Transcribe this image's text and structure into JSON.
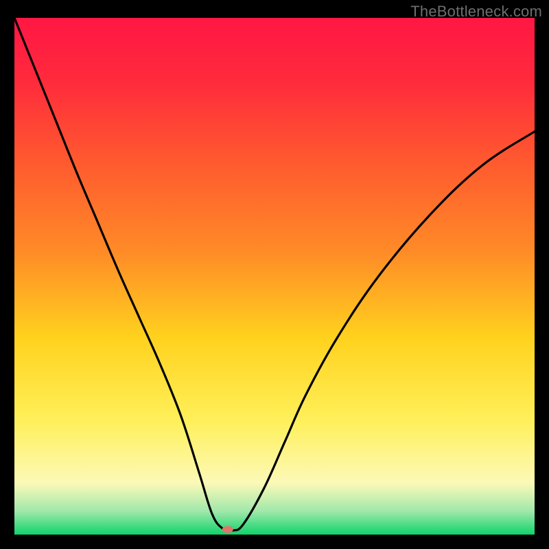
{
  "watermark": "TheBottleneck.com",
  "chart_data": {
    "type": "line",
    "title": "",
    "xlabel": "",
    "ylabel": "",
    "xlim": [
      0,
      100
    ],
    "ylim": [
      0,
      100
    ],
    "grid": false,
    "legend": false,
    "background_gradient": {
      "stops": [
        {
          "offset": 0.0,
          "color": "#ff1744"
        },
        {
          "offset": 0.12,
          "color": "#ff2a3c"
        },
        {
          "offset": 0.28,
          "color": "#ff5a2f"
        },
        {
          "offset": 0.45,
          "color": "#ff8a27"
        },
        {
          "offset": 0.62,
          "color": "#ffd21e"
        },
        {
          "offset": 0.78,
          "color": "#fff05a"
        },
        {
          "offset": 0.9,
          "color": "#fcf9b8"
        },
        {
          "offset": 0.955,
          "color": "#9fe8aa"
        },
        {
          "offset": 1.0,
          "color": "#0fd36a"
        }
      ]
    },
    "series": [
      {
        "name": "bottleneck-curve",
        "x": [
          0,
          4,
          8,
          12,
          16,
          20,
          24,
          28,
          32,
          35.5,
          38,
          40,
          42,
          44,
          48,
          52,
          56,
          62,
          70,
          80,
          90,
          100
        ],
        "y": [
          100,
          90,
          80,
          70,
          60.5,
          51,
          42,
          33,
          23,
          12,
          4,
          1.2,
          0.8,
          2,
          9,
          18,
          27,
          38,
          50,
          62,
          71.5,
          78
        ]
      }
    ],
    "marker": {
      "name": "optimal-point",
      "x": 41,
      "y": 1,
      "color": "#e4736a",
      "rx": 8,
      "ry": 5
    }
  }
}
